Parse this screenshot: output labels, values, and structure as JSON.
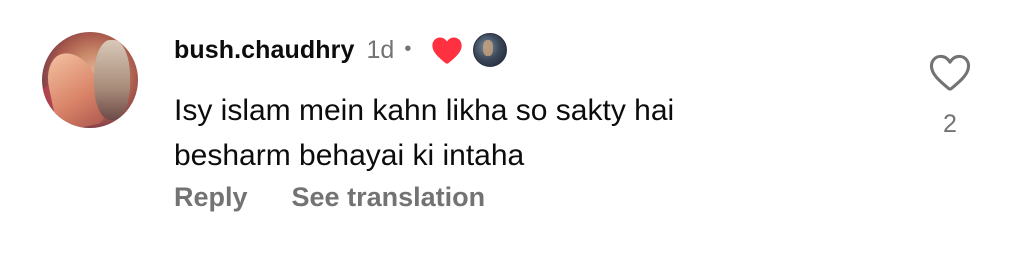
{
  "comment": {
    "username": "bush.chaudhry",
    "time": "1d",
    "separator": "•",
    "text_line1": "Isy islam mein kahn likha so sakty hai",
    "text_line2": "besharm behayai ki intaha",
    "reply_label": "Reply",
    "translate_label": "See translation",
    "like_count": "2",
    "liked_by_author": true
  },
  "icons": {
    "avatar": "profile-photo",
    "liked_heart": "heart-filled-icon",
    "author_avatar": "author-profile-photo",
    "like": "heart-outline-icon"
  },
  "colors": {
    "text": "#0c0c0c",
    "secondary": "#737373",
    "heart_red": "#ff3040",
    "background": "#ffffff"
  }
}
